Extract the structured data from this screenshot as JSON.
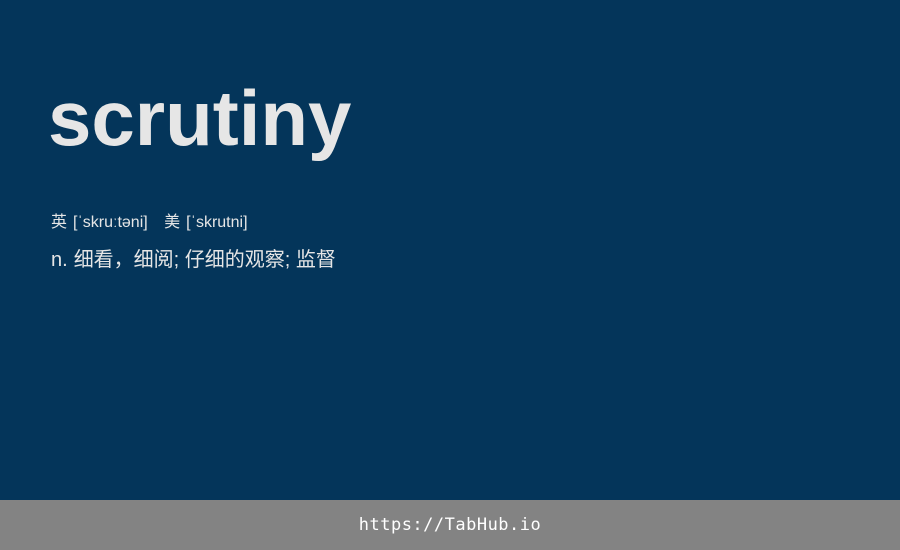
{
  "entry": {
    "word": "scrutiny",
    "phonetics": {
      "uk_label": "英",
      "uk_ipa": "[ˈskruːtəni]",
      "us_label": "美",
      "us_ipa": "[ˈskrutni]"
    },
    "definition": {
      "pos": "n.",
      "meaning": "细看，细阅; 仔细的观察; 监督"
    }
  },
  "footer": {
    "link_text": "https://TabHub.io"
  },
  "colors": {
    "background": "#04355a",
    "text": "#e6e6e6",
    "footer_background": "#838383",
    "footer_text": "#ffffff"
  }
}
